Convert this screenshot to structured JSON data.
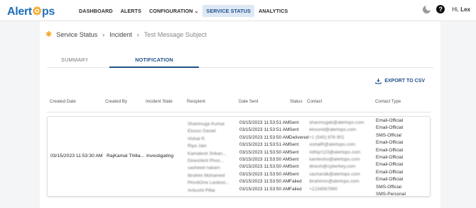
{
  "brand": {
    "part1": "Alert",
    "part2": "ps"
  },
  "nav": {
    "items": [
      {
        "label": "DASHBOARD"
      },
      {
        "label": "ALERTS"
      },
      {
        "label": "CONFIGURATION"
      },
      {
        "label": "SERVICE STATUS",
        "active": true
      },
      {
        "label": "ANALYTICS"
      }
    ]
  },
  "user": {
    "greeting": "Hi,",
    "name": "Lex"
  },
  "breadcrumb": {
    "root": "Service Status",
    "mid": "Incident",
    "current": "Test Message Subject"
  },
  "tabs": {
    "summary": "SUMMARY",
    "notification": "NOTIFICATION"
  },
  "export_label": "EXPORT TO CSV",
  "table": {
    "headers": {
      "created_date": "Created Date",
      "created_by": "Created By",
      "incident_state": "Incident State",
      "recipient": "Recipient",
      "date_sent": "Date Sent",
      "status": "Status",
      "contact": "Contact",
      "contact_type": "Contact Type"
    },
    "row": {
      "created_date": "03/15/2023 11:53:30 AM",
      "created_by": "RajKamal Thilla...",
      "incident_state": "Investigating",
      "recipients": [
        "Shanmuga Kumar",
        "Elsson Daniel",
        "Vishal R",
        "Riya Jain",
        "Kamalesh Srikan...",
        "Dineshkrit Phon...",
        "sasheed nakam",
        "Ibrahim Mohamed",
        "PAmitOne Lastkon...",
        "Ankushi Pillai"
      ],
      "date_sent": [
        "03/15/2023 11:53:51 AM",
        "03/15/2023 11:53:51 AM",
        "03/15/2023 11:53:50 AM",
        "03/15/2023 11:53:51 AM",
        "03/15/2023 11:53:50 AM",
        "03/15/2023 11:53:50 AM",
        "03/15/2023 11:53:50 AM",
        "03/15/2023 11:53:50 AM",
        "03/15/2023 11:53:50 AM",
        "03/15/2023 11:53:50 AM"
      ],
      "status": [
        "Sent",
        "Sent",
        "Delivered",
        "Sent",
        "Sent",
        "Sent",
        "Sent",
        "Sent",
        "Failed",
        "Failed"
      ],
      "contacts": [
        "shanmugak@alertops.com",
        "elssond@alertops.com",
        "+1 (540) 678 901",
        "vishalR@alertops.com",
        "ridhiyr123@alertops.com",
        "kamlesho@alertops.com",
        "dinesh@cyberkey.com",
        "sachandk@alertops.com",
        "ibrahimm@alertops.com",
        "+1234567890"
      ],
      "contact_types": [
        "Email-Official",
        "Email-Official",
        "SMS-Official",
        "Email-Official",
        "Email-Official",
        "Email-Official",
        "Email-Official",
        "Email-Official",
        "Email-Official",
        "SMS-Official",
        "SMS-Personal"
      ]
    }
  },
  "colors": {
    "brand_blue": "#1f6fb8",
    "brand_orange": "#f5a623",
    "accent": "#1f4f8a"
  }
}
